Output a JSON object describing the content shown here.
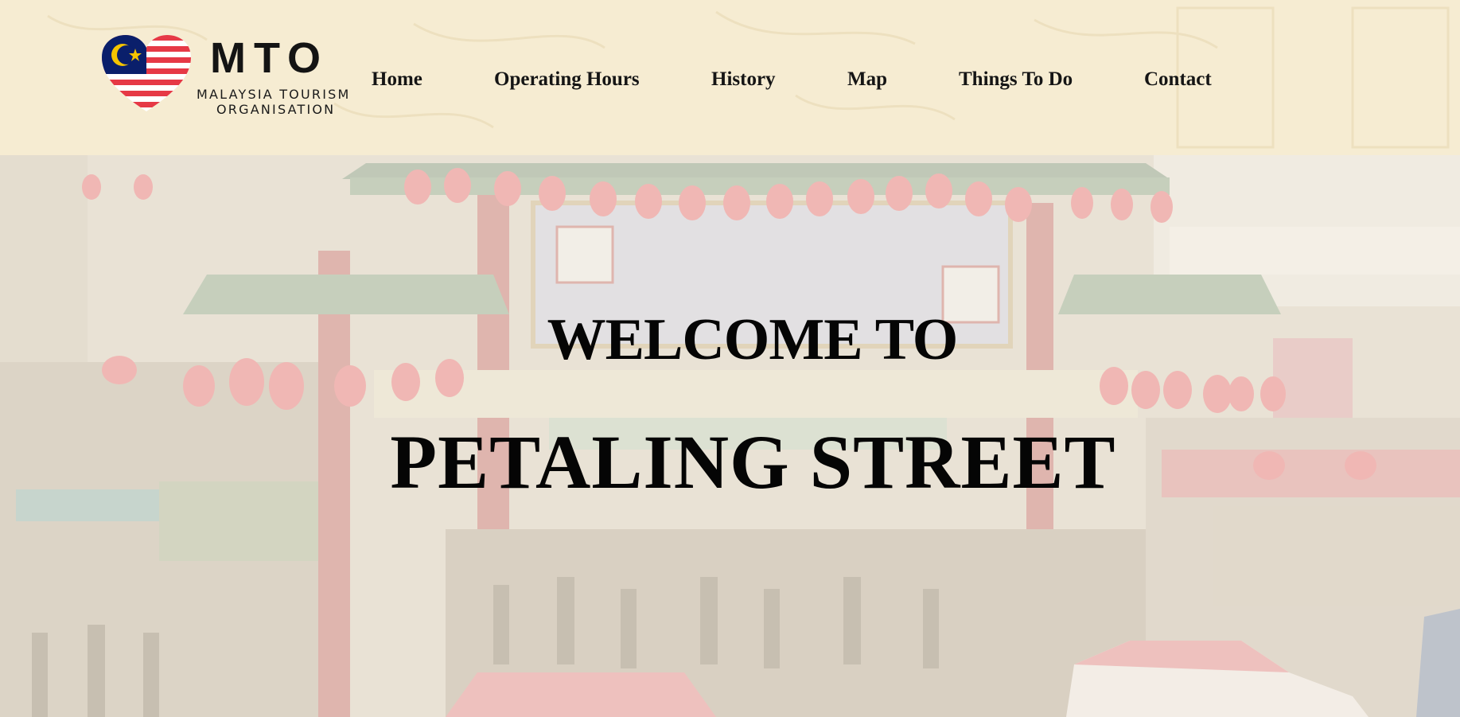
{
  "logo": {
    "abbr": "MTO",
    "line1": "MALAYSIA TOURISM",
    "line2": "ORGANISATION"
  },
  "nav": {
    "items": [
      {
        "label": "Home"
      },
      {
        "label": "Operating Hours"
      },
      {
        "label": "History"
      },
      {
        "label": "Map"
      },
      {
        "label": "Things To Do"
      },
      {
        "label": "Contact"
      }
    ]
  },
  "hero": {
    "line1": "WELCOME TO",
    "line2": "PETALING STREET"
  },
  "colors": {
    "header_bg": "#f6ecd2",
    "text": "#151515",
    "flag_red": "#e63946",
    "flag_blue": "#0a1f6b",
    "flag_yellow": "#f5c400"
  }
}
